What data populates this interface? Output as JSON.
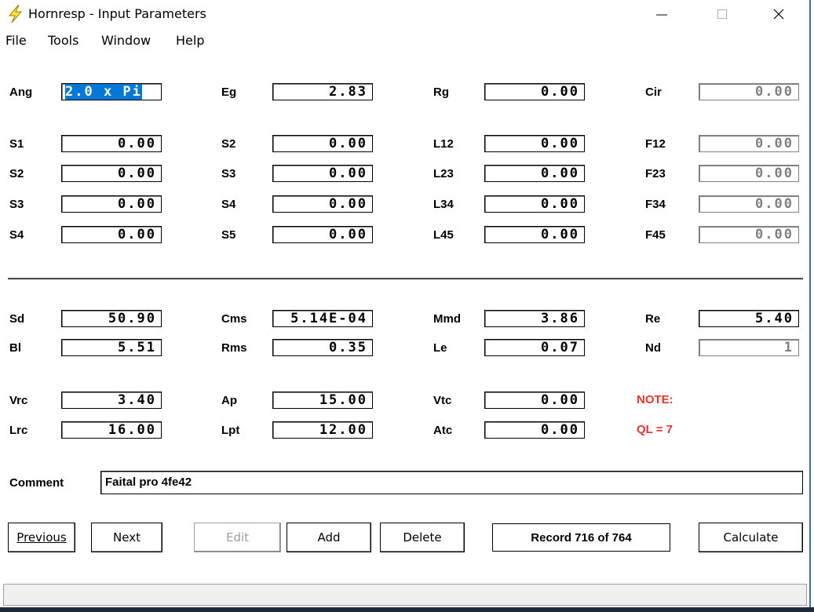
{
  "window": {
    "title": "Hornresp - Input Parameters"
  },
  "menu": [
    "File",
    "Tools",
    "Window",
    "Help"
  ],
  "row_top": [
    {
      "label": "Ang",
      "value": "2.0 x Pi",
      "selected": true
    },
    {
      "label": "Eg",
      "value": "2.83"
    },
    {
      "label": "Rg",
      "value": "0.00"
    },
    {
      "label": "Cir",
      "value": "0.00",
      "disabled": true
    }
  ],
  "section1": [
    [
      {
        "label": "S1",
        "value": "0.00"
      },
      {
        "label": "S2",
        "value": "0.00"
      },
      {
        "label": "L12",
        "value": "0.00"
      },
      {
        "label": "F12",
        "value": "0.00",
        "disabled": true
      }
    ],
    [
      {
        "label": "S2",
        "value": "0.00"
      },
      {
        "label": "S3",
        "value": "0.00"
      },
      {
        "label": "L23",
        "value": "0.00"
      },
      {
        "label": "F23",
        "value": "0.00",
        "disabled": true
      }
    ],
    [
      {
        "label": "S3",
        "value": "0.00"
      },
      {
        "label": "S4",
        "value": "0.00"
      },
      {
        "label": "L34",
        "value": "0.00"
      },
      {
        "label": "F34",
        "value": "0.00",
        "disabled": true
      }
    ],
    [
      {
        "label": "S4",
        "value": "0.00"
      },
      {
        "label": "S5",
        "value": "0.00"
      },
      {
        "label": "L45",
        "value": "0.00"
      },
      {
        "label": "F45",
        "value": "0.00",
        "disabled": true
      }
    ]
  ],
  "section2": [
    [
      {
        "label": "Sd",
        "value": "50.90"
      },
      {
        "label": "Cms",
        "value": "5.14E-04"
      },
      {
        "label": "Mmd",
        "value": "3.86"
      },
      {
        "label": "Re",
        "value": "5.40"
      }
    ],
    [
      {
        "label": "Bl",
        "value": "5.51"
      },
      {
        "label": "Rms",
        "value": "0.35"
      },
      {
        "label": "Le",
        "value": "0.07"
      },
      {
        "label": "Nd",
        "value": "1",
        "disabled": true
      }
    ]
  ],
  "section3": [
    [
      {
        "label": "Vrc",
        "value": "3.40"
      },
      {
        "label": "Ap",
        "value": "15.00"
      },
      {
        "label": "Vtc",
        "value": "0.00"
      }
    ],
    [
      {
        "label": "Lrc",
        "value": "16.00"
      },
      {
        "label": "Lpt",
        "value": "12.00"
      },
      {
        "label": "Atc",
        "value": "0.00"
      }
    ]
  ],
  "note": {
    "title": "NOTE:",
    "text": "QL = 7",
    "color": "#e8332a"
  },
  "comment": {
    "label": "Comment",
    "value": "Faital pro 4fe42"
  },
  "buttons": {
    "previous": "Previous",
    "next": "Next",
    "edit": "Edit",
    "add": "Add",
    "delete": "Delete",
    "calculate": "Calculate"
  },
  "record": "Record 716 of 764"
}
